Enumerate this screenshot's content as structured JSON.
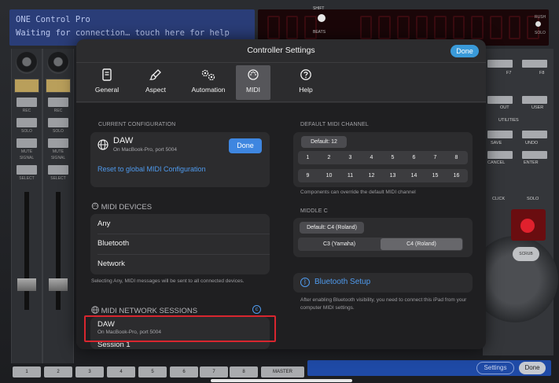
{
  "console": {
    "lcd_line1": "ONE Control Pro",
    "lcd_line2": "Waiting for connection… touch here for help",
    "shift_label": "SHIFT",
    "beats_label": "BEATS",
    "rush_label": "RUSH",
    "solo_label": "SOLO",
    "channel_numbers": [
      "1",
      "2",
      "3",
      "4",
      "5",
      "6",
      "7",
      "8"
    ],
    "master_label": "MASTER",
    "strip_buttons": [
      "REC",
      "SOLO",
      "MUTE",
      "SIGNAL",
      "SELECT"
    ],
    "settings_button": "Settings",
    "done_button": "Done",
    "right_labels": {
      "f7": "F7",
      "f8": "F8",
      "out": "OUT",
      "user": "USER",
      "utilities": "UTILITIES",
      "save": "SAVE",
      "undo": "UNDO",
      "cancel": "CANCEL",
      "enter": "ENTER",
      "click": "CLICK",
      "solo": "SOLO",
      "scrub": "SCRUB"
    }
  },
  "modal": {
    "title": "Controller Settings",
    "done_label": "Done",
    "tabs": [
      {
        "label": "General",
        "icon": "document-icon"
      },
      {
        "label": "Aspect",
        "icon": "brush-icon"
      },
      {
        "label": "Automation",
        "icon": "gears-icon"
      },
      {
        "label": "MIDI",
        "icon": "midi-port-icon"
      },
      {
        "label": "Help",
        "icon": "question-icon"
      }
    ],
    "current_config": {
      "header": "CURRENT CONFIGURATION",
      "name": "DAW",
      "subtitle": "On MacBook-Pro, port 5004",
      "done_label": "Done",
      "reset_link": "Reset to global MIDI Configuration"
    },
    "midi_devices": {
      "header": "MIDI DEVICES",
      "items": [
        "Any",
        "Bluetooth",
        "Network"
      ],
      "note": "Selecting Any, MIDI messages will be sent to all connected devices."
    },
    "network_sessions": {
      "header": "MIDI NETWORK SESSIONS",
      "info_glyph": "c",
      "items": [
        {
          "name": "DAW",
          "subtitle": "On MacBook-Pro, port 5004"
        },
        {
          "name": "Session 1"
        }
      ]
    },
    "default_channel": {
      "header": "DEFAULT MIDI CHANNEL",
      "default_label": "Default: 12",
      "row1": [
        "1",
        "2",
        "3",
        "4",
        "5",
        "6",
        "7",
        "8"
      ],
      "row2": [
        "9",
        "10",
        "11",
        "12",
        "13",
        "14",
        "15",
        "16"
      ],
      "note": "Components can override the default MIDI channel"
    },
    "middle_c": {
      "header": "MIDDLE C",
      "default_label": "Default: C4 (Roland)",
      "options": [
        "C3 (Yamaha)",
        "C4 (Roland)"
      ],
      "selected": "C4 (Roland)"
    },
    "bluetooth": {
      "label": "Bluetooth Setup",
      "note": "After enabling Bluetooth visibility, you need to connect this iPad from your computer MIDI settings."
    }
  },
  "colors": {
    "accent_blue": "#3e86e0",
    "link_blue": "#4f9bef",
    "highlight_red": "#d8262f",
    "lcd_blue": "#2a3d78"
  }
}
